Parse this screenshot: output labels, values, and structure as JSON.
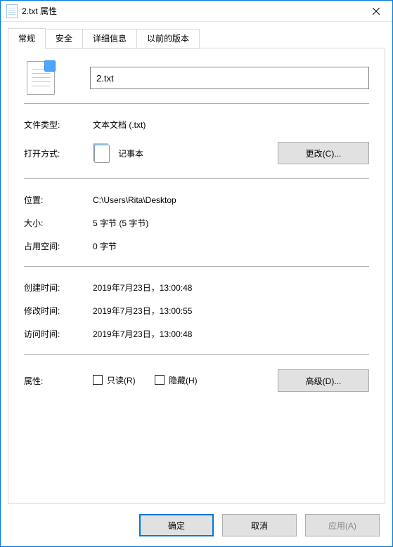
{
  "titlebar": {
    "title": "2.txt 属性"
  },
  "tabs": {
    "general": "常规",
    "security": "安全",
    "details": "详细信息",
    "previous": "以前的版本"
  },
  "filename": {
    "value": "2.txt"
  },
  "labels": {
    "filetype": "文件类型:",
    "opens_with": "打开方式:",
    "location": "位置:",
    "size": "大小:",
    "size_on_disk": "占用空间:",
    "created": "创建时间:",
    "modified": "修改时间:",
    "accessed": "访问时间:",
    "attributes": "属性:"
  },
  "values": {
    "filetype": "文本文档 (.txt)",
    "opens_with": "记事本",
    "location": "C:\\Users\\Rita\\Desktop",
    "size": "5 字节 (5 字节)",
    "size_on_disk": "0 字节",
    "created": "2019年7月23日，13:00:48",
    "modified": "2019年7月23日，13:00:55",
    "accessed": "2019年7月23日，13:00:48"
  },
  "buttons": {
    "change": "更改(C)...",
    "advanced": "高级(D)...",
    "ok": "确定",
    "cancel": "取消",
    "apply": "应用(A)"
  },
  "checkboxes": {
    "readonly": "只读(R)",
    "hidden": "隐藏(H)"
  }
}
